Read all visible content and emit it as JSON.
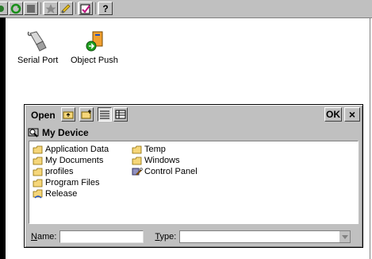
{
  "toolbar": {
    "buttons": [
      "connect-icon",
      "refresh-icon",
      "stop-icon",
      "favorite-icon",
      "pencil-icon",
      "properties-icon",
      "help-icon"
    ],
    "help_label": "?"
  },
  "desktop": {
    "icons": [
      {
        "label": "Serial Port",
        "icon": "serial-port-icon"
      },
      {
        "label": "Object Push",
        "icon": "object-push-icon"
      }
    ]
  },
  "dialog": {
    "title": "Open",
    "ok_label": "OK",
    "close_label": "×",
    "location": "My Device",
    "folders_col1": [
      "Application Data",
      "My Documents",
      "profiles",
      "Program Files",
      "Release"
    ],
    "folders_col2": [
      "Temp",
      "Windows",
      "Control Panel"
    ],
    "name_label_u": "N",
    "name_label_rest": "ame:",
    "name_value": "",
    "type_label_u": "T",
    "type_label_rest": "ype:",
    "type_value": ""
  },
  "colors": {
    "folder": "#f5d67a",
    "chrome": "#c0c0c0"
  }
}
